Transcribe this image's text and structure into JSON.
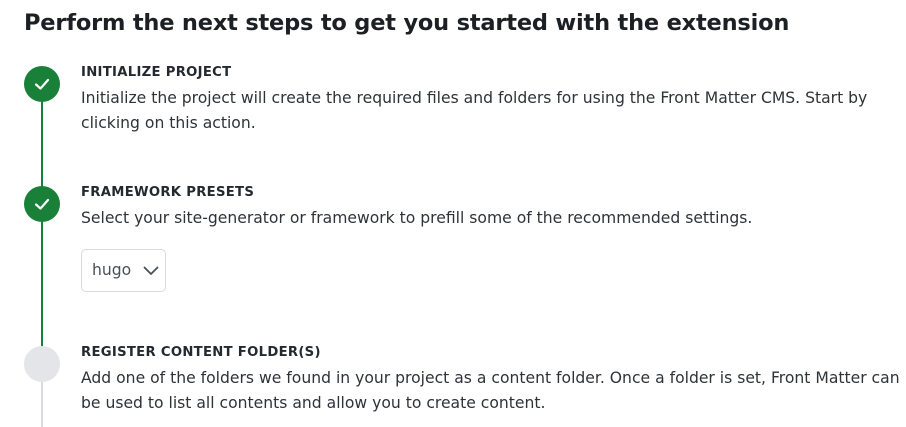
{
  "page": {
    "title": "Perform the next steps to get you started with the extension"
  },
  "steps": [
    {
      "status": "done",
      "status_icon": "check-icon",
      "title": "INITIALIZE PROJECT",
      "description": "Initialize the project will create the required files and folders for using the Front Matter CMS. Start by clicking on this action."
    },
    {
      "status": "done",
      "status_icon": "check-icon",
      "title": "FRAMEWORK PRESETS",
      "description": "Select your site-generator or framework to prefill some of the recommended settings.",
      "select": {
        "value": "hugo",
        "icon": "chevron-down-icon"
      }
    },
    {
      "status": "pending",
      "title": "REGISTER CONTENT FOLDER(S)",
      "description": "Add one of the folders we found in your project as a content folder. Once a folder is set, Front Matter can be used to list all contents and allow you to create content."
    }
  ],
  "colors": {
    "done": "#188038",
    "pending": "#e3e5e8",
    "rail_pending": "#d8dadd"
  }
}
